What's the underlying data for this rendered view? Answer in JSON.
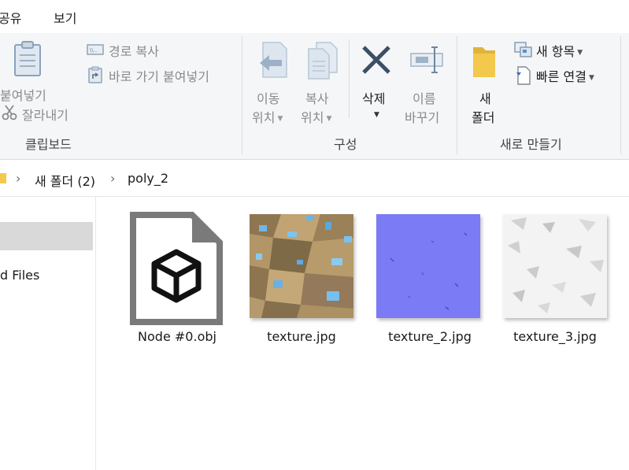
{
  "menu": {
    "share_tab": "공유",
    "view_tab": "보기"
  },
  "ribbon": {
    "clipboard": {
      "paste_label": "붙여넣기",
      "cut_label": "잘라내기",
      "copy_path_label": "경로 복사",
      "paste_shortcut_label": "바로 가기 붙여넣기",
      "group_label": "클립보드"
    },
    "organize": {
      "move_to_line1": "이동",
      "move_to_line2": "위치",
      "copy_to_line1": "복사",
      "copy_to_line2": "위치",
      "delete_label": "삭제",
      "rename_line1": "이름",
      "rename_line2": "바꾸기",
      "group_label": "구성"
    },
    "new": {
      "new_folder_line1": "새",
      "new_folder_line2": "폴더",
      "new_item_label": "새 항목",
      "easy_access_label": "빠른 연결",
      "group_label": "새로 만들기"
    }
  },
  "breadcrumb": {
    "folder": "새 폴더 (2)",
    "subfolder": "poly_2"
  },
  "nav": {
    "item_label": "d Files"
  },
  "files": [
    {
      "name": "Node #0.obj"
    },
    {
      "name": "texture.jpg"
    },
    {
      "name": "texture_2.jpg"
    },
    {
      "name": "texture_3.jpg"
    }
  ],
  "colors": {
    "ribbon_bg": "#f5f6f7",
    "selection": "#d9d9d9",
    "folder": "#f2c94c",
    "delete_x": "#3c4f66"
  }
}
